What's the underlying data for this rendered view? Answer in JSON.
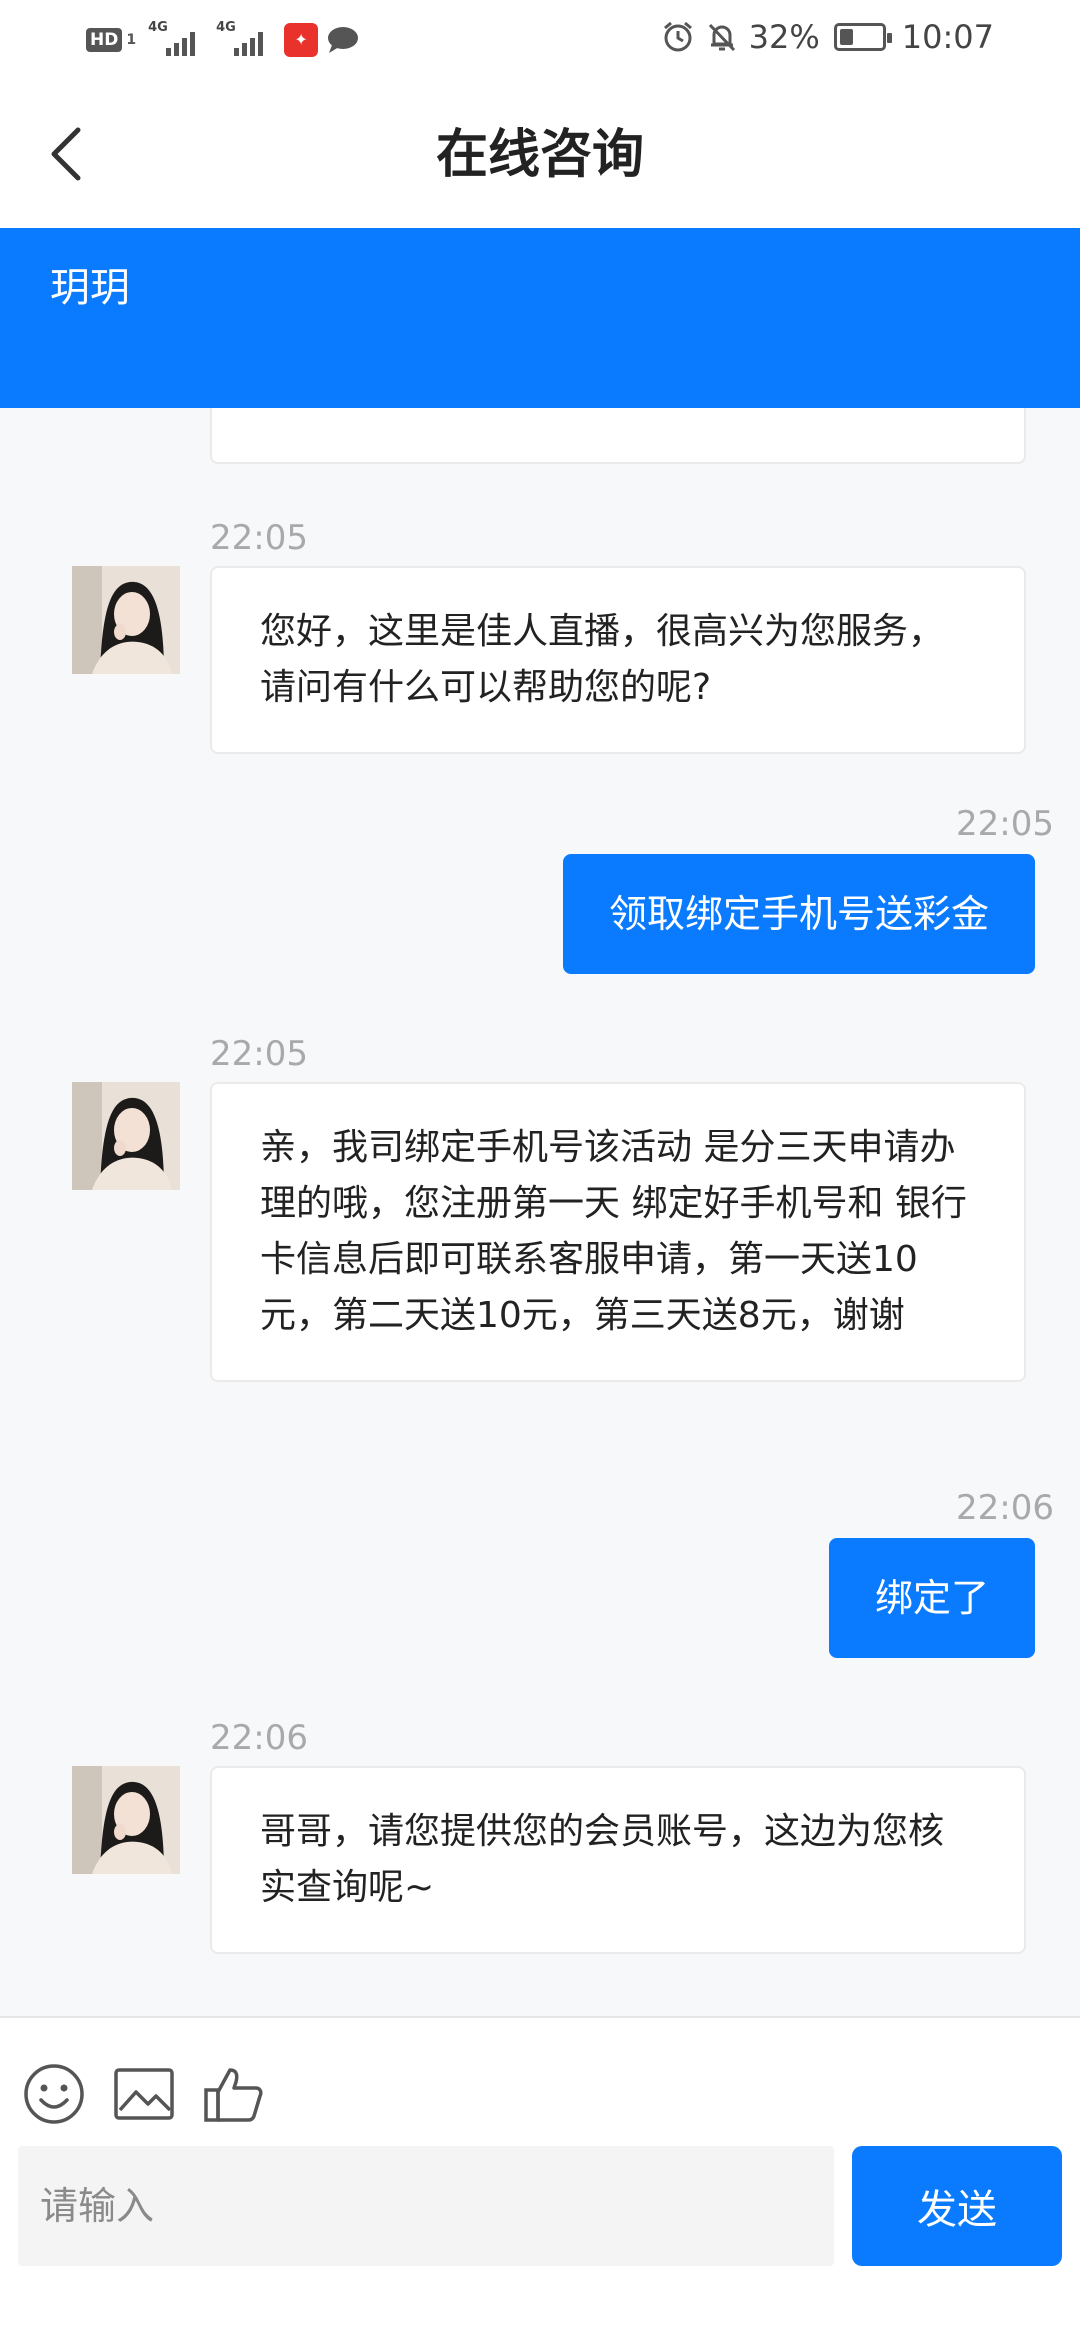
{
  "status_bar": {
    "hd": "HD",
    "hd_sub": "1",
    "net1": "4G",
    "net2": "4G",
    "battery": "32%",
    "battery_level": 0.32,
    "time": "10:07",
    "app_badge_icon": "red-app-icon",
    "notify_icon": "chat-bubble-icon",
    "alarm_icon": "alarm-icon",
    "mute_icon": "bell-off-icon"
  },
  "header": {
    "title": "在线咨询",
    "back_icon": "chevron-left-icon"
  },
  "agent": {
    "name": "玥玥"
  },
  "colors": {
    "accent": "#0a7bff",
    "bubble_in": "#ffffff",
    "timestamp": "#a9a9a9"
  },
  "messages": [
    {
      "from": "agent",
      "time": "22:05",
      "text": "您好，这里是佳人直播，很高兴为您服务，请问有什么可以帮助您的呢?"
    },
    {
      "from": "user",
      "time": "22:05",
      "text": "领取绑定手机号送彩金"
    },
    {
      "from": "agent",
      "time": "22:05",
      "text": "亲，我司绑定手机号该活动 是分三天申请办理的哦，您注册第一天 绑定好手机号和 银行卡信息后即可联系客服申请，第一天送10元，第二天送10元，第三天送8元，谢谢"
    },
    {
      "from": "user",
      "time": "22:06",
      "text": "绑定了"
    },
    {
      "from": "agent",
      "time": "22:06",
      "text": "哥哥，请您提供您的会员账号，这边为您核实查询呢~"
    }
  ],
  "input": {
    "placeholder": "请输入",
    "value": "",
    "send_label": "发送",
    "tools": [
      "emoji-icon",
      "image-icon",
      "thumbs-up-icon"
    ]
  }
}
